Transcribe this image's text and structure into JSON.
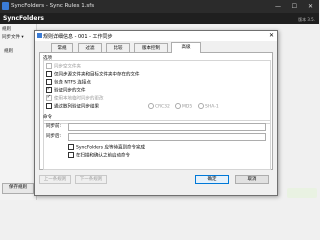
{
  "app": {
    "title": "SyncFolders - Sync Rules 1.sfs",
    "logo": "SyncFolders",
    "version": "版本 3.5.",
    "left_labels": [
      "规则",
      "同步文件 ▾",
      "规则"
    ],
    "left_button": "保存规则"
  },
  "dialog": {
    "title": "规则详细信息 - 001 - 工作同步",
    "close": "✕",
    "tabs": [
      {
        "label": "常规",
        "active": false
      },
      {
        "label": "过滤",
        "active": false
      },
      {
        "label": "比较",
        "active": false
      },
      {
        "label": "版本控制",
        "active": false
      },
      {
        "label": "高级",
        "active": true
      }
    ],
    "options_header": "选项",
    "options": [
      {
        "label": "同步空文件夹",
        "checked": false,
        "disabled": true
      },
      {
        "label": "仅同步源文件夹和目标文件夹中存在的文件",
        "checked": false,
        "disabled": false
      },
      {
        "label": "包含 NTFS 连接点",
        "checked": false,
        "disabled": false
      },
      {
        "label": "验证同步的文件",
        "checked": true,
        "disabled": false
      },
      {
        "label": "使用本地临时同步的更改",
        "checked": true,
        "disabled": true
      },
      {
        "label": "通过散列验证同步结果",
        "checked": false,
        "disabled": false
      }
    ],
    "hash_options": [
      "CRC32",
      "MD5",
      "SHA-1"
    ],
    "command_header": "命令",
    "before_sync_label": "同步前:",
    "after_sync_label": "同步后:",
    "before_sync_value": "",
    "after_sync_value": "",
    "cmd_options": [
      {
        "label": "SyncFolders 应等待直到命令完成",
        "checked": false
      },
      {
        "label": "在扫描和确认之前启动命令",
        "checked": false
      }
    ],
    "prev_button": "上一条规则",
    "next_button": "下一条规则",
    "ok_button": "确定",
    "cancel_button": "取消"
  }
}
